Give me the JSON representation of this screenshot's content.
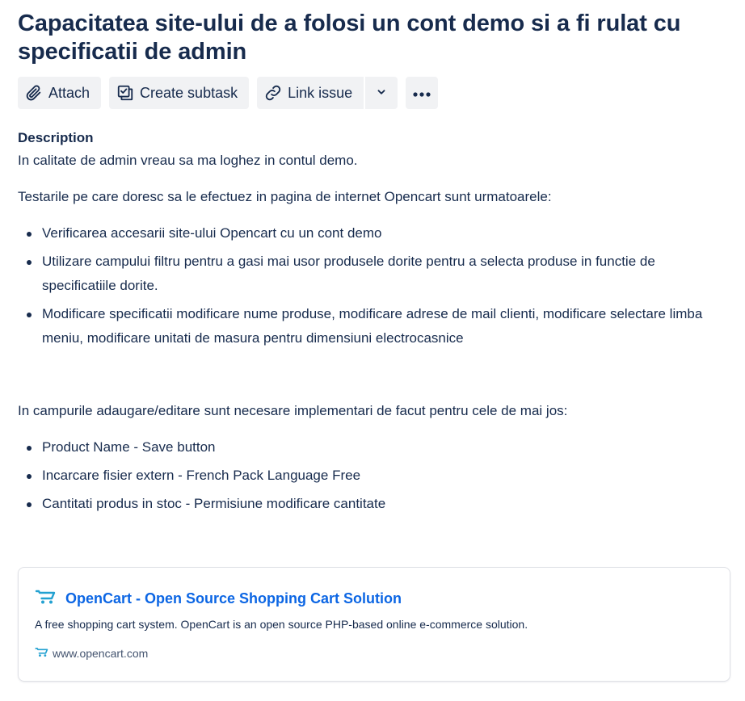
{
  "issue": {
    "title": "Capacitatea site-ului de a folosi un cont demo si a fi rulat cu specificatii de admin"
  },
  "toolbar": {
    "attach_label": "Attach",
    "create_subtask_label": "Create subtask",
    "link_issue_label": "Link issue"
  },
  "description": {
    "label": "Description",
    "intro": "In calitate de admin vreau sa ma loghez in contul demo.",
    "tests_intro": "Testarile pe care doresc sa le efectuez in pagina de internet Opencart sunt urmatoarele:",
    "tests": [
      "Verificarea accesarii site-ului Opencart cu un cont demo",
      "Utilizare campului filtru pentru a gasi mai usor produsele dorite pentru a selecta produse in functie de specificatiile dorite.",
      "Modificare specificatii modificare nume produse, modificare adrese de mail clienti, modificare selectare limba meniu, modificare unitati de masura pentru dimensiuni electrocasnice"
    ],
    "fields_intro": "In campurile adaugare/editare sunt necesare implementari de facut pentru cele de mai jos:",
    "fields": [
      "Product Name - Save button",
      "Incarcare fisier extern - French Pack Language Free",
      "Cantitati produs in stoc - Permisiune modificare cantitate"
    ]
  },
  "link_card": {
    "title": "OpenCart - Open Source Shopping Cart Solution",
    "description": "A free shopping cart system. OpenCart is an open source PHP-based online e-commerce solution.",
    "url": "www.opencart.com",
    "icon": "cart-icon"
  },
  "colors": {
    "text": "#172b4d",
    "link": "#0c66e4",
    "button_bg": "#f1f2f4",
    "cart_icon": "#23a1d1"
  }
}
